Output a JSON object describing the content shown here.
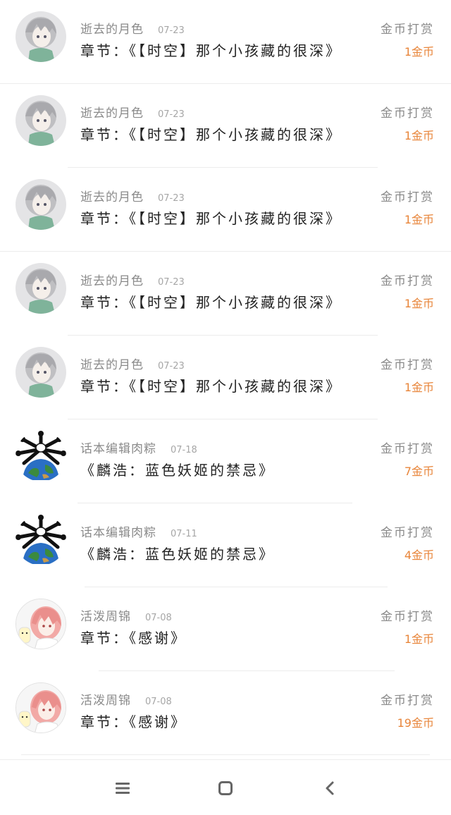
{
  "rewards": [
    {
      "name": "逝去的月色",
      "date": "07-23",
      "title": "章节：《【时空】那个小孩藏的很深》",
      "tip_label": "金币打赏",
      "amount": "1金币",
      "avatar": "grey-hair-avatar"
    },
    {
      "name": "逝去的月色",
      "date": "07-23",
      "title": "章节：《【时空】那个小孩藏的很深》",
      "tip_label": "金币打赏",
      "amount": "1金币",
      "avatar": "grey-hair-avatar"
    },
    {
      "name": "逝去的月色",
      "date": "07-23",
      "title": "章节：《【时空】那个小孩藏的很深》",
      "tip_label": "金币打赏",
      "amount": "1金币",
      "avatar": "grey-hair-avatar"
    },
    {
      "name": "逝去的月色",
      "date": "07-23",
      "title": "章节：《【时空】那个小孩藏的很深》",
      "tip_label": "金币打赏",
      "amount": "1金币",
      "avatar": "grey-hair-avatar"
    },
    {
      "name": "逝去的月色",
      "date": "07-23",
      "title": "章节：《【时空】那个小孩藏的很深》",
      "tip_label": "金币打赏",
      "amount": "1金币",
      "avatar": "grey-hair-avatar"
    },
    {
      "name": "话本编辑肉粽",
      "date": "07-18",
      "title": "《麟浩：蓝色妖姬的禁忌》",
      "tip_label": "金币打赏",
      "amount": "7金币",
      "avatar": "globe-crossbones-avatar"
    },
    {
      "name": "话本编辑肉粽",
      "date": "07-11",
      "title": "《麟浩：蓝色妖姬的禁忌》",
      "tip_label": "金币打赏",
      "amount": "4金币",
      "avatar": "globe-crossbones-avatar"
    },
    {
      "name": "活泼周锦",
      "date": "07-08",
      "title": "章节：《感谢》",
      "tip_label": "金币打赏",
      "amount": "1金币",
      "avatar": "pink-hair-avatar"
    },
    {
      "name": "活泼周锦",
      "date": "07-08",
      "title": "章节：《感谢》",
      "tip_label": "金币打赏",
      "amount": "19金币",
      "avatar": "pink-hair-avatar"
    }
  ],
  "navbar": {
    "items": [
      "menu-icon",
      "home-square-icon",
      "back-chevron-icon"
    ]
  },
  "colors": {
    "amount": "#e8853a",
    "name": "#8a8a8a",
    "title": "#222222",
    "divider": "#ececec"
  }
}
